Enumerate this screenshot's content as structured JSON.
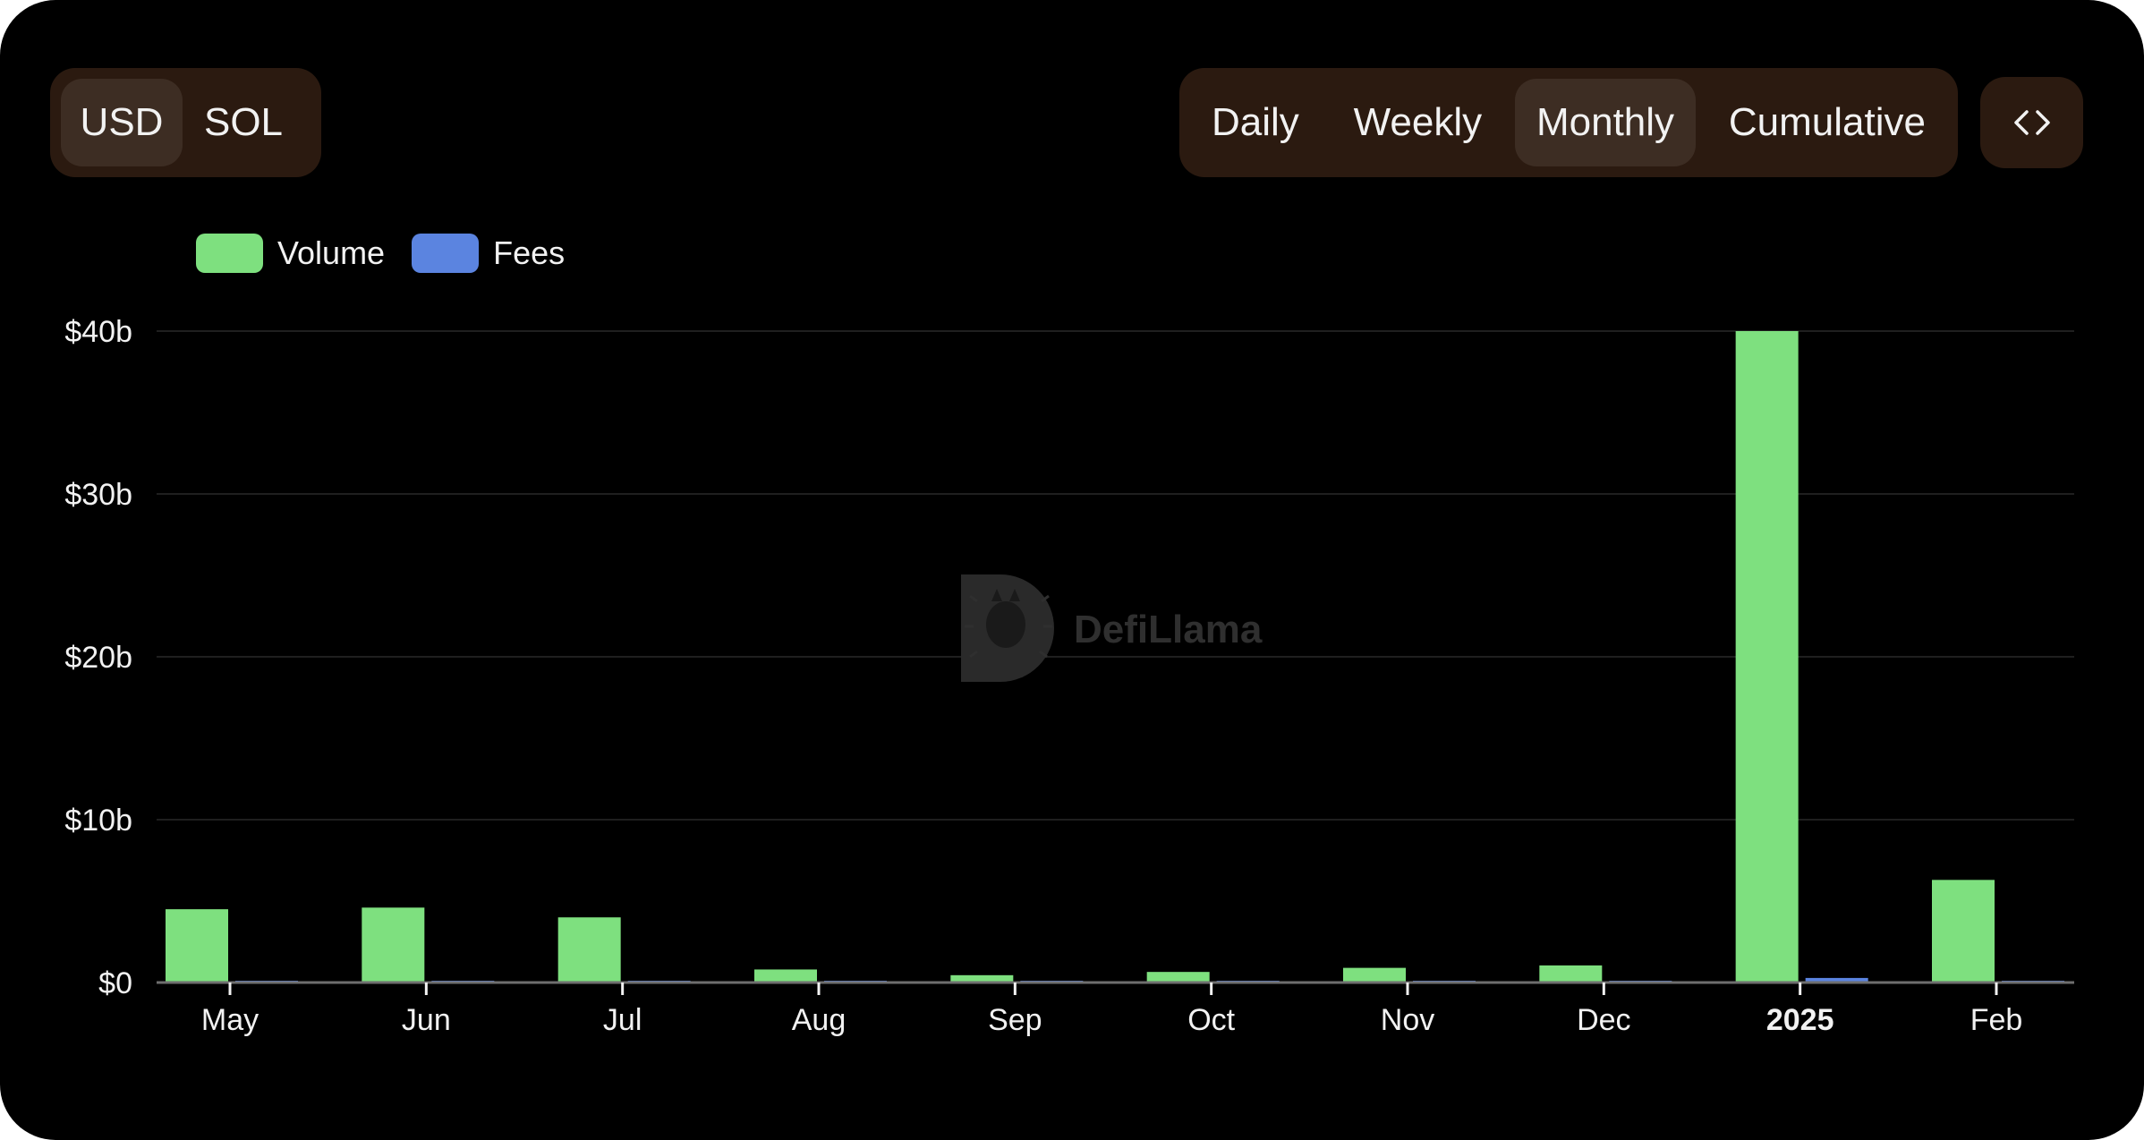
{
  "toolbar": {
    "currency_options": [
      {
        "label": "USD",
        "active": true
      },
      {
        "label": "SOL",
        "active": false
      }
    ],
    "period_options": [
      {
        "label": "Daily",
        "active": false
      },
      {
        "label": "Weekly",
        "active": false
      },
      {
        "label": "Monthly",
        "active": true
      },
      {
        "label": "Cumulative",
        "active": false
      }
    ],
    "embed_icon": "code-brackets-icon"
  },
  "watermark": {
    "text": "DefiLlama"
  },
  "colors": {
    "background": "#000000",
    "volume": "#7ee07f",
    "fees": "#5b84e0",
    "toggle_bg": "#2b1a10",
    "toggle_active": "#3d2d23"
  },
  "chart_data": {
    "type": "bar",
    "categories": [
      "May",
      "Jun",
      "Jul",
      "Aug",
      "Sep",
      "Oct",
      "Nov",
      "Dec",
      "2025",
      "Feb"
    ],
    "bold_categories": [
      "2025"
    ],
    "series": [
      {
        "name": "Volume",
        "color": "#7ee07f",
        "values": [
          4.5,
          4.6,
          4.0,
          0.8,
          0.45,
          0.65,
          0.9,
          1.05,
          40.0,
          6.3
        ]
      },
      {
        "name": "Fees",
        "color": "#5b84e0",
        "values": [
          0.02,
          0.02,
          0.02,
          0.005,
          0.003,
          0.004,
          0.005,
          0.006,
          0.28,
          0.05
        ]
      }
    ],
    "ylim": [
      0,
      40
    ],
    "yticks": [
      0,
      10,
      20,
      30,
      40
    ],
    "ytick_labels": [
      "$0",
      "$10b",
      "$20b",
      "$30b",
      "$40b"
    ],
    "grid": true,
    "legend_position": "top-left"
  }
}
